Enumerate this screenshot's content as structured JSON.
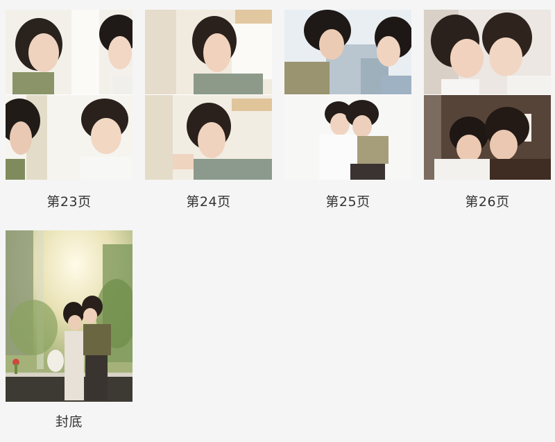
{
  "pages": [
    {
      "label": "第23页"
    },
    {
      "label": "第24页"
    },
    {
      "label": "第25页"
    },
    {
      "label": "第26页"
    }
  ],
  "back_cover": {
    "label": "封底"
  },
  "colors": {
    "background": "#f5f5f5",
    "caption": "#333333"
  }
}
